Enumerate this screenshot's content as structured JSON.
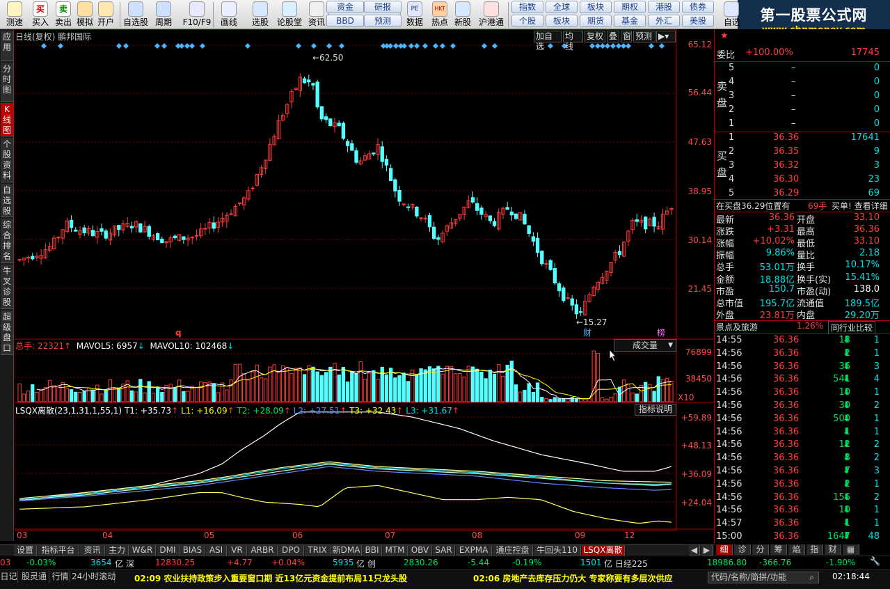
{
  "toolbar": {
    "items": [
      {
        "label": "测速",
        "icon": "clock-icon"
      },
      {
        "label": "买入",
        "icon": "buy-icon"
      },
      {
        "label": "卖出",
        "icon": "sell-icon"
      },
      {
        "label": "模拟",
        "icon": "gavel-icon"
      },
      {
        "label": "开户",
        "icon": "lock-icon"
      },
      {
        "label": "自选股",
        "icon": "home-icon"
      },
      {
        "label": "周期",
        "icon": "cycle-icon"
      },
      {
        "label": "F10/F9",
        "icon": "f10-icon"
      },
      {
        "label": "画线",
        "icon": "pencil-icon"
      },
      {
        "label": "选股",
        "icon": "select-icon"
      },
      {
        "label": "论股堂",
        "icon": "forum-icon"
      },
      {
        "label": "资讯",
        "icon": "news-icon"
      },
      {
        "label": "数据",
        "icon": "data-icon"
      },
      {
        "label": "热点",
        "icon": "hot-icon"
      },
      {
        "label": "新股",
        "icon": "newstock-icon"
      },
      {
        "label": "沪港通",
        "icon": "hkconnect-icon"
      },
      {
        "label": "自选",
        "icon": "star-icon"
      }
    ],
    "mid_buttons_top": [
      "资金",
      "研报"
    ],
    "mid_buttons_bottom": [
      "BBD",
      "预测"
    ],
    "right_buttons_top": [
      "指数",
      "全球",
      "板块",
      "期权",
      "港股",
      "债券"
    ],
    "right_buttons_bottom": [
      "个股",
      "板块",
      "期货",
      "基金",
      "外汇",
      "美股"
    ],
    "pe_label": "PE",
    "hkt_label": "HKT",
    "ad_line1": "第一股票公式网",
    "ad_line2": "www.chnmoney.com"
  },
  "left_tabs": [
    "应用",
    "分时图",
    "K线图",
    "个股资料",
    "自选股",
    "综合排名",
    "牛叉诊股",
    "超级盘口"
  ],
  "chart": {
    "title": "日线(复权) 鹏邦国际",
    "header_buttons": [
      "加自选",
      "均线",
      "复权",
      "叠",
      "窗",
      "预测"
    ],
    "price_axis": [
      "65.12",
      "56.44",
      "47.63",
      "38.95",
      "30.14",
      "21.45"
    ],
    "high_label": "62.50",
    "low_label": "15.27",
    "cai_label": "财",
    "bang_label": "榜",
    "q_label": "q",
    "vol_header": {
      "prefix": "总手:",
      "value": "22321",
      "ma5": "MAVOL5: 6957",
      "ma10": "MAVOL10: 102468"
    },
    "vol_selector": "成交量",
    "vol_axis": [
      "76899",
      "38450",
      "X10"
    ],
    "ind_header": {
      "name": "LSQX离散(23,1,31,1,55,1)",
      "t1": "T1: +35.73",
      "l1": "L1: +16.09",
      "t2": "T2: +28.09",
      "l2": "L2: +27.51",
      "t3": "T3: +32.43",
      "l3": "L3: +31.67"
    },
    "ind_help": "指标说明",
    "ind_axis": [
      "+59.89",
      "+48.13",
      "+36.09",
      "+24.04"
    ],
    "x_ticks": [
      "03",
      "04",
      "05",
      "06",
      "07",
      "08",
      "09",
      "12"
    ],
    "colors": {
      "up": "#ff3b3b",
      "down": "#54ffff",
      "grid": "#7a0000",
      "axis": "#ff4a4a"
    }
  },
  "bottom_tabs": [
    "设置",
    "指标平台",
    "资讯",
    "主力",
    "W&R",
    "DMI",
    "BIAS",
    "ASI",
    "VR",
    "ARBR",
    "DPO",
    "TRIX",
    "新DMA",
    "BBI",
    "MTM",
    "OBV",
    "SAR",
    "EXPMA",
    "通庄控盘",
    "牛回头110",
    "LSQX离散"
  ],
  "right_panel": {
    "webi_label": "委比",
    "webi_value": "+100.00%",
    "webi_qty": "17745",
    "sell_label": "卖盘",
    "sells": [
      {
        "lvl": "5",
        "p": "–",
        "q": "0"
      },
      {
        "lvl": "4",
        "p": "–",
        "q": "0"
      },
      {
        "lvl": "3",
        "p": "–",
        "q": "0"
      },
      {
        "lvl": "2",
        "p": "–",
        "q": "0"
      },
      {
        "lvl": "1",
        "p": "–",
        "q": "0"
      }
    ],
    "buy_label": "买盘",
    "buys": [
      {
        "lvl": "1",
        "p": "36.36",
        "q": "17641"
      },
      {
        "lvl": "2",
        "p": "36.35",
        "q": "9"
      },
      {
        "lvl": "3",
        "p": "36.32",
        "q": "3"
      },
      {
        "lvl": "4",
        "p": "36.30",
        "q": "23"
      },
      {
        "lvl": "5",
        "p": "36.29",
        "q": "69"
      }
    ],
    "buy_note": "在买盘36.29位置有",
    "buy_note_qty": "69手",
    "buy_note_link": "买单! 查看详细",
    "stats": [
      [
        "最新",
        "36.36",
        "开盘",
        "33.10"
      ],
      [
        "涨跌",
        "+3.31",
        "最高",
        "36.36"
      ],
      [
        "涨幅",
        "+10.02%",
        "最低",
        "33.10"
      ],
      [
        "振幅",
        "9.86%",
        "量比",
        "2.18"
      ],
      [
        "总手",
        "53.01万",
        "换手",
        "10.17%"
      ],
      [
        "金额",
        "18.88亿",
        "换手(实)",
        "15.41%"
      ],
      [
        "市盈",
        "150.7",
        "市盈(动)",
        "138.0"
      ],
      [
        "总市值",
        "195.7亿",
        "流通值",
        "189.5亿"
      ],
      [
        "外盘",
        "23.81万",
        "内盘",
        "29.20万"
      ]
    ],
    "industry": "景点及旅游",
    "industry_pct": "1.26%",
    "industry_btn": "同行业比较",
    "ticks": [
      [
        "14:55",
        "36.36",
        "13",
        "1"
      ],
      [
        "14:56",
        "36.36",
        "2",
        "1"
      ],
      [
        "14:56",
        "36.36",
        "36",
        "3"
      ],
      [
        "14:56",
        "36.36",
        "541",
        "4"
      ],
      [
        "14:56",
        "36.36",
        "10",
        "1"
      ],
      [
        "14:56",
        "36.36",
        "30",
        "2"
      ],
      [
        "14:56",
        "36.36",
        "500",
        "1"
      ],
      [
        "14:56",
        "36.36",
        "1",
        "1"
      ],
      [
        "14:56",
        "36.36",
        "12",
        "2"
      ],
      [
        "14:56",
        "36.36",
        "3",
        "2"
      ],
      [
        "14:56",
        "36.36",
        "7",
        "3"
      ],
      [
        "14:56",
        "36.36",
        "2",
        "1"
      ],
      [
        "14:56",
        "36.36",
        "156",
        "2"
      ],
      [
        "14:56",
        "36.36",
        "10",
        "1"
      ],
      [
        "14:57",
        "36.36",
        "1",
        "1"
      ],
      [
        "15:00",
        "36.36",
        "1647",
        "48"
      ]
    ],
    "bottom_tabs": [
      "细",
      "诊",
      "分",
      "筹",
      "焰",
      "指",
      "财"
    ]
  },
  "ticker": {
    "items": [
      {
        "t": "03",
        "c": "#ff3c3c"
      },
      {
        "t": "-0.03%",
        "c": "#00e060"
      },
      {
        "t": "3654",
        "c": "#00e0e0"
      },
      {
        "t": "亿 深",
        "c": "#ddd"
      },
      {
        "t": "12830.25",
        "c": "#ff3c3c"
      },
      {
        "t": "+4.77",
        "c": "#ff3c3c"
      },
      {
        "t": "+0.04%",
        "c": "#ff3c3c"
      },
      {
        "t": "5935",
        "c": "#00e0e0"
      },
      {
        "t": "亿 创",
        "c": "#ddd"
      },
      {
        "t": "2830.26",
        "c": "#00e060"
      },
      {
        "t": "-5.44",
        "c": "#00e060"
      },
      {
        "t": "-0.19%",
        "c": "#00e060"
      },
      {
        "t": "1501",
        "c": "#00e0e0"
      },
      {
        "t": "亿 日经225",
        "c": "#ddd"
      },
      {
        "t": "18986.80",
        "c": "#00e060"
      },
      {
        "t": "-366.76",
        "c": "#00e060"
      },
      {
        "t": "-1.90%",
        "c": "#00e060"
      }
    ]
  },
  "status": {
    "tabs": [
      "日记",
      "股灵通",
      "行情",
      "24小时滚动"
    ],
    "news1": "02:09 农业扶持政策步入重要窗口期  近13亿元资金提前布局11只龙头股",
    "news2": "02:06 房地产去库存压力仍大  专家称要有多层次供应",
    "search_placeholder": "代码/名称/简拼/功能",
    "time": "02:18:44"
  }
}
